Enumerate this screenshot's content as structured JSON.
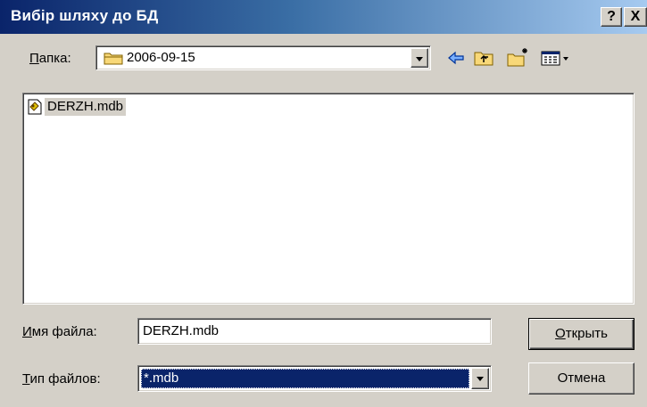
{
  "window": {
    "title": "Вибір шляху до БД",
    "help_glyph": "?",
    "close_glyph": "X"
  },
  "look_in": {
    "label_prefix": "П",
    "label_rest": "апка:",
    "value": "2006-09-15",
    "icon": "folder-icon"
  },
  "toolbar": {
    "icons": [
      "back-arrow-icon",
      "up-folder-icon",
      "new-folder-icon",
      "view-menu-icon"
    ]
  },
  "files": [
    {
      "name": "DERZH.mdb",
      "icon": "database-file-icon"
    }
  ],
  "filename": {
    "label_prefix": "И",
    "label_rest": "мя файла:",
    "value": "DERZH.mdb"
  },
  "filetype": {
    "label_prefix": "Т",
    "label_rest": "ип файлов:",
    "value": "*.mdb"
  },
  "buttons": {
    "open_prefix": "О",
    "open_rest": "ткрыть",
    "cancel": "Отмена"
  },
  "colors": {
    "title_bar": "#0a246a",
    "face": "#d4d0c8",
    "selection": "#0a246a"
  }
}
